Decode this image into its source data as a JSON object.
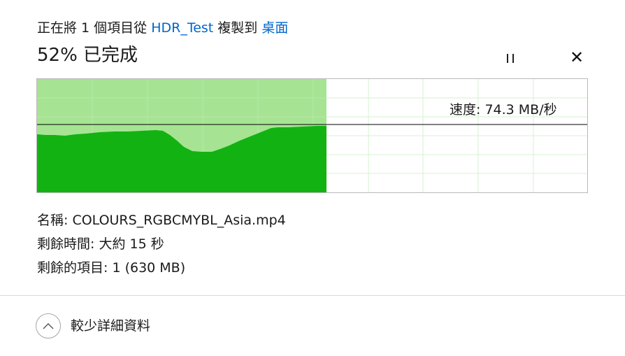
{
  "header": {
    "prefix": "正在將 1 個項目從 ",
    "source": "HDR_Test",
    "middle": " 複製到 ",
    "destination": "桌面",
    "progress_text": "52% 已完成",
    "progress": 0.52
  },
  "controls": {
    "pause_icon": "pause-icon",
    "close_icon": "close-icon",
    "close_glyph": "✕"
  },
  "graph": {
    "speed_text": "速度: 74.3 MB/秒",
    "colors": {
      "fill_light": "#a6e494",
      "fill_dark": "#13b213",
      "grid": "#d7f0d2",
      "speed_line": "#000000"
    }
  },
  "details": {
    "name": "名稱:  COLOURS_RGBCMYBL_Asia.mp4",
    "time_remaining": "剩餘時間:  大約 15 秒",
    "items_remaining": "剩餘的項目:  1 (630 MB)"
  },
  "footer": {
    "less_details": "較少詳細資料",
    "chevron_icon": "chevron-up-icon"
  }
}
